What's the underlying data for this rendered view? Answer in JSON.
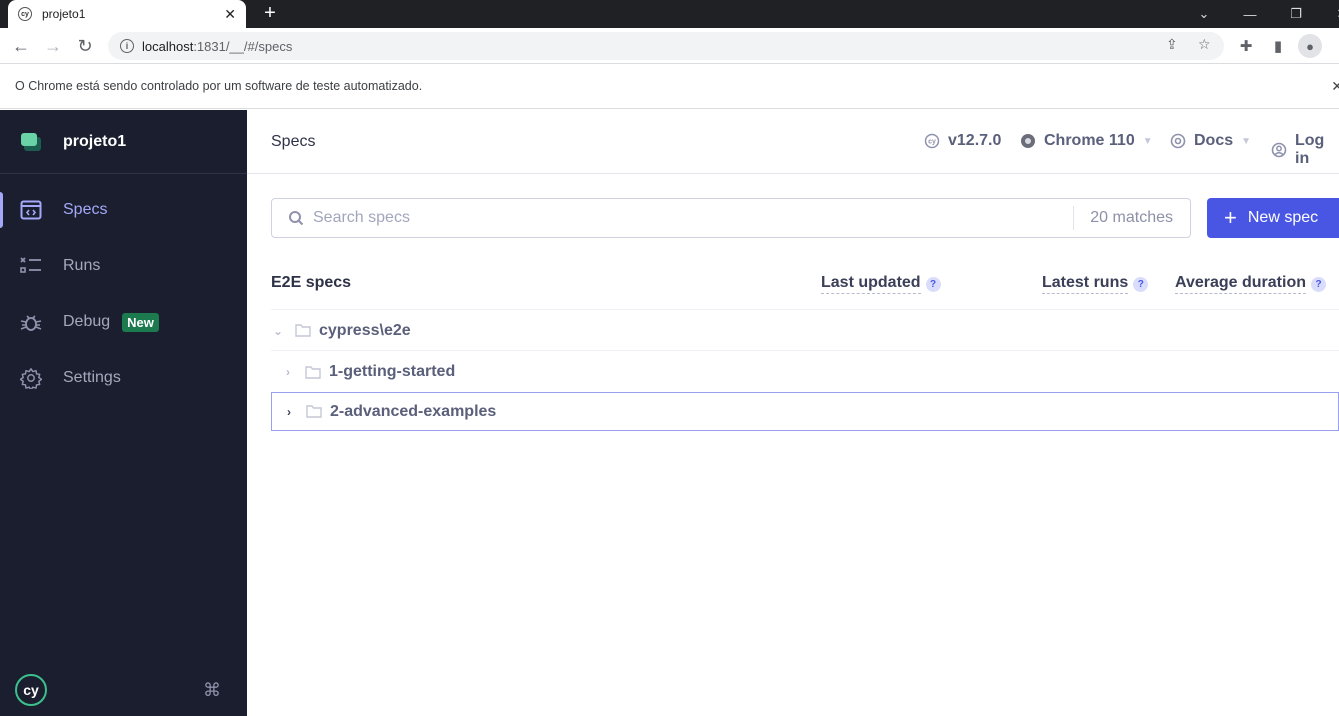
{
  "browser": {
    "tab_title": "projeto1",
    "tab_favicon": "cypress-icon",
    "url_host": "localhost",
    "url_rest": ":1831/__/#/specs",
    "infobar_text": "O Chrome está sendo controlado por um software de teste automatizado."
  },
  "sidebar": {
    "project_name": "projeto1",
    "items": [
      {
        "label": "Specs",
        "icon": "code-window-icon",
        "active": true
      },
      {
        "label": "Runs",
        "icon": "runs-list-icon"
      },
      {
        "label": "Debug",
        "icon": "bug-icon",
        "badge": "New"
      },
      {
        "label": "Settings",
        "icon": "gear-icon"
      }
    ],
    "shortcut_icon": "command-key-icon"
  },
  "header": {
    "title": "Specs",
    "version": "v12.7.0",
    "browser": "Chrome 110",
    "docs": "Docs",
    "login": "Log in"
  },
  "search": {
    "placeholder": "Search specs",
    "value": "",
    "matches": "20 matches"
  },
  "new_spec_label": "New spec",
  "columns": {
    "title": "E2E specs",
    "last_updated": "Last updated",
    "latest_runs": "Latest runs",
    "average_duration": "Average duration",
    "help": "?"
  },
  "tree": [
    {
      "name": "cypress\\e2e",
      "expanded": true
    },
    {
      "name": "1-getting-started",
      "expanded": false
    },
    {
      "name": "2-advanced-examples",
      "expanded": false,
      "focused": true
    }
  ],
  "colors": {
    "accent": "#4956e3",
    "sidebar_bg": "#1b1e2e",
    "active_nav": "#a3a8f9",
    "badge_green": "#1b7a4e"
  }
}
